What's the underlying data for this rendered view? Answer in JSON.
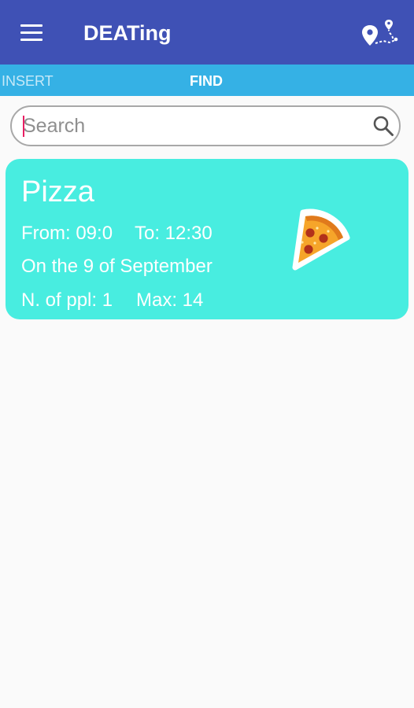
{
  "appbar": {
    "menu_icon": "hamburger-menu-icon",
    "title": "DEATing",
    "map_icon": "map-route-icon"
  },
  "tabs": [
    {
      "label": "INSERT",
      "selected": false
    },
    {
      "label": "FIND",
      "selected": true
    }
  ],
  "search": {
    "placeholder": "Search",
    "value": "",
    "icon": "search-icon"
  },
  "events": [
    {
      "title": "Pizza",
      "from": "From: 09:0",
      "to": "To: 12:30",
      "date": "On the 9 of September",
      "people": "N. of ppl: 1",
      "max": "Max: 14",
      "icon": "pizza-slice-icon"
    }
  ],
  "colors": {
    "appbar": "#3f51b5",
    "tabbar": "#35b1e5",
    "card": "#48ede0",
    "cursor": "#e91e63",
    "background": "#fafafa"
  }
}
